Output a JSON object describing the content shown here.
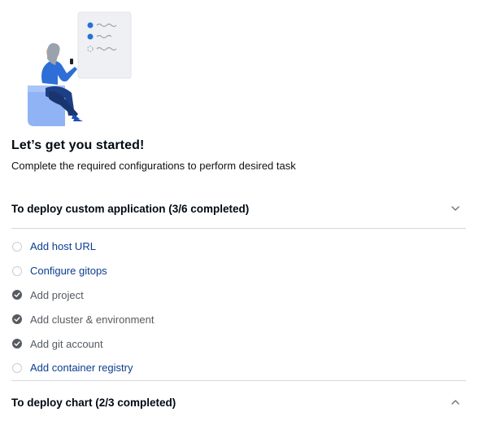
{
  "page": {
    "title": "Let’s get you started!",
    "subtitle": "Complete the required configurations to perform desired task"
  },
  "sections": [
    {
      "title": "To deploy custom application (3/6 completed)",
      "expanded": true,
      "chevron": "chevron-down-icon",
      "tasks": [
        {
          "label": "Add host URL",
          "completed": false
        },
        {
          "label": "Configure gitops",
          "completed": false
        },
        {
          "label": "Add project",
          "completed": true
        },
        {
          "label": "Add cluster & environment",
          "completed": true
        },
        {
          "label": "Add git account",
          "completed": true
        },
        {
          "label": "Add container registry",
          "completed": false
        }
      ]
    },
    {
      "title": "To deploy chart (2/3 completed)",
      "expanded": false,
      "chevron": "chevron-up-icon"
    }
  ],
  "colors": {
    "link": "#0b3d91",
    "done_text": "#555b61",
    "check_fill": "#555b61",
    "illustration_accent": "#2d6fd6"
  }
}
